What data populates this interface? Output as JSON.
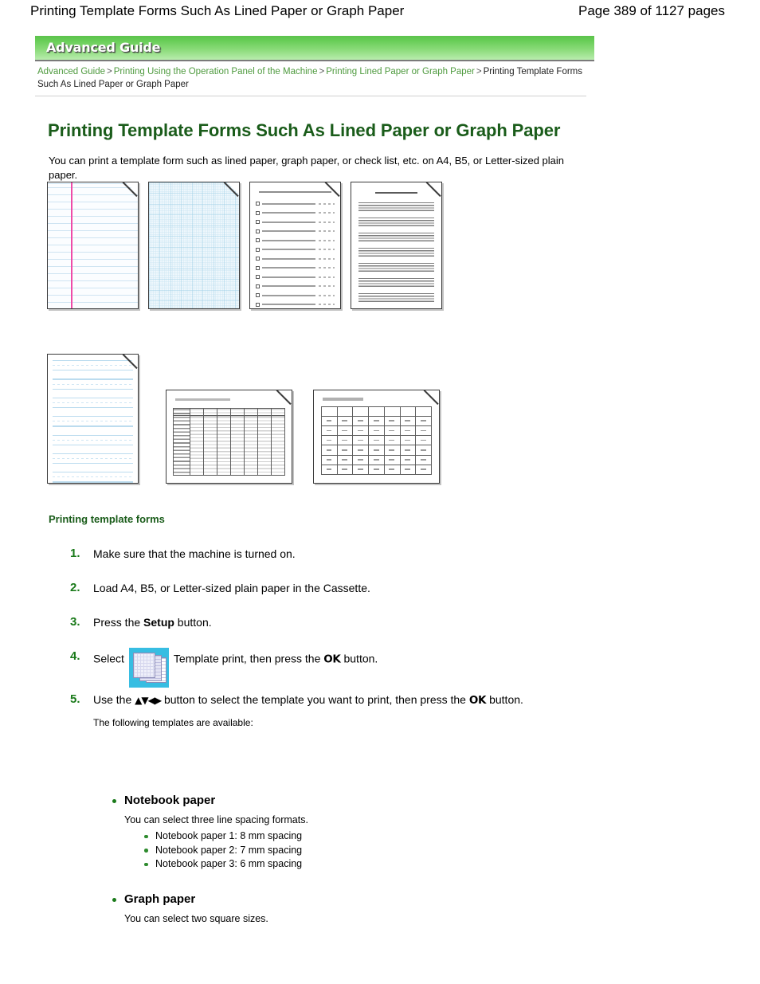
{
  "header": {
    "doc_title": "Printing Template Forms Such As Lined Paper or Graph Paper",
    "page_count": "Page 389 of 1127 pages"
  },
  "banner": {
    "label": "Advanced Guide"
  },
  "breadcrumb": {
    "item1": "Advanced Guide",
    "sep1": ">",
    "item2": "Printing Using the Operation Panel of the Machine",
    "sep2": ">",
    "item3": "Printing Lined Paper or Graph Paper",
    "sep3": ">",
    "current": "Printing Template Forms Such As Lined Paper or Graph Paper"
  },
  "main": {
    "heading": "Printing Template Forms Such As Lined Paper or Graph Paper",
    "intro": "You can print a template form such as lined paper, graph paper, or check list, etc. on A4, B5, or Letter-sized plain paper.",
    "section_subhead": "Printing template forms"
  },
  "thumbnails": [
    {
      "name": "notebook-paper",
      "pattern": "notebook"
    },
    {
      "name": "graph-paper",
      "pattern": "graph"
    },
    {
      "name": "checklist",
      "pattern": "check"
    },
    {
      "name": "staff-paper",
      "pattern": "staff"
    },
    {
      "name": "handwriting-paper",
      "pattern": "hand"
    },
    {
      "name": "weekly-schedule",
      "pattern": "sched"
    },
    {
      "name": "monthly-calendar",
      "pattern": "cal"
    }
  ],
  "steps": [
    {
      "num": "1.",
      "text": "Make sure that the machine is turned on."
    },
    {
      "num": "2.",
      "text": "Load A4, B5, or Letter-sized plain paper in the Cassette."
    },
    {
      "num": "3.",
      "text_before": "Press the ",
      "bold": "Setup",
      "text_after": " button."
    },
    {
      "num": "4.",
      "text_before": "Select",
      "icon": "template-print-icon",
      "text_mid": "Template print, then press the ",
      "ok": "OK",
      "text_after": " button."
    },
    {
      "num": "5.",
      "text_before": "Use the ",
      "arrows": "▲▼◀▶",
      "text_mid": " button to select the template you want to print, then press the ",
      "ok": "OK",
      "text_after": " button.",
      "note": "The following templates are available:"
    }
  ],
  "templates": [
    {
      "title": "Notebook paper",
      "description": "You can select three line spacing formats.",
      "options": [
        "Notebook paper 1: 8 mm spacing",
        "Notebook paper 2: 7 mm spacing",
        "Notebook paper 3: 6 mm spacing"
      ]
    },
    {
      "title": "Graph paper",
      "description": "You can select two square sizes.",
      "options": []
    }
  ],
  "colors": {
    "heading_green": "#1a5c1a",
    "link_green": "#4e9a3e",
    "step_num_green": "#1a7a1a",
    "banner_green": "#66cc55",
    "icon_cyan": "#37bde2",
    "margin_pink": "#ef4ba8"
  }
}
